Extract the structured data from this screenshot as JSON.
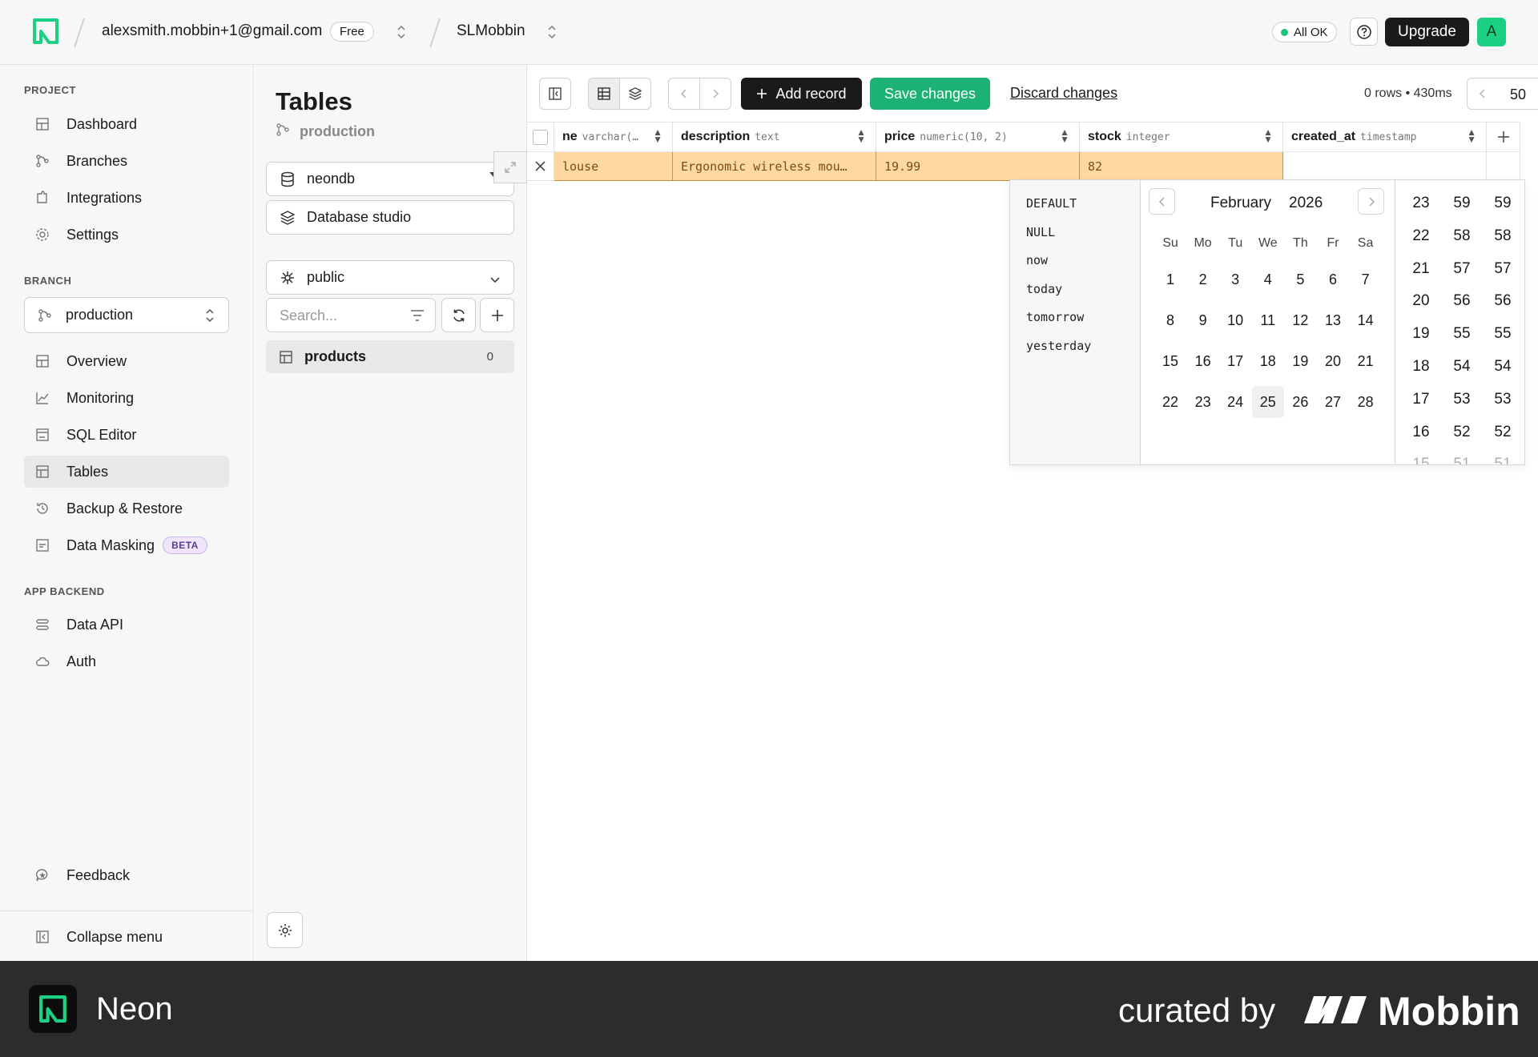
{
  "topbar": {
    "account_email": "alexsmith.mobbin+1@gmail.com",
    "plan_badge": "Free",
    "project_name": "SLMobbin",
    "status": "All OK",
    "upgrade_label": "Upgrade",
    "avatar_initial": "A"
  },
  "sidebar": {
    "project_label": "PROJECT",
    "project_items": [
      "Dashboard",
      "Branches",
      "Integrations",
      "Settings"
    ],
    "branch_label": "BRANCH",
    "branch_value": "production",
    "branch_items": [
      "Overview",
      "Monitoring",
      "SQL Editor",
      "Tables",
      "Backup & Restore",
      "Data Masking"
    ],
    "beta_badge": "BETA",
    "app_backend_label": "APP BACKEND",
    "app_items": [
      "Data API",
      "Auth"
    ],
    "feedback": "Feedback",
    "collapse": "Collapse menu"
  },
  "tables_panel": {
    "title": "Tables",
    "branch": "production",
    "database": "neondb",
    "studio": "Database studio",
    "schema": "public",
    "search_placeholder": "Search...",
    "table_name": "products",
    "table_count": "0"
  },
  "toolbar": {
    "add_record": "Add record",
    "save_changes": "Save changes",
    "discard_changes": "Discard changes",
    "row_info": "0 rows • 430ms",
    "page_size": "50"
  },
  "grid": {
    "columns": [
      {
        "name": "ne",
        "type": "varchar(…"
      },
      {
        "name": "description",
        "type": "text"
      },
      {
        "name": "price",
        "type": "numeric(10, 2)"
      },
      {
        "name": "stock",
        "type": "integer"
      },
      {
        "name": "created_at",
        "type": "timestamp"
      }
    ],
    "row": [
      "louse",
      "Ergonomic wireless mou…",
      "19.99",
      "82",
      ""
    ]
  },
  "datepicker": {
    "presets": [
      "DEFAULT",
      "NULL",
      "now",
      "today",
      "tomorrow",
      "yesterday"
    ],
    "month": "February",
    "year": "2026",
    "weekdays": [
      "Su",
      "Mo",
      "Tu",
      "We",
      "Th",
      "Fr",
      "Sa"
    ],
    "days": [
      "1",
      "2",
      "3",
      "4",
      "5",
      "6",
      "7",
      "8",
      "9",
      "10",
      "11",
      "12",
      "13",
      "14",
      "15",
      "16",
      "17",
      "18",
      "19",
      "20",
      "21",
      "22",
      "23",
      "24",
      "25",
      "26",
      "27",
      "28"
    ],
    "selected_day": "25",
    "hours": [
      "23",
      "22",
      "21",
      "20",
      "19",
      "18",
      "17",
      "16",
      "15"
    ],
    "minutes": [
      "59",
      "58",
      "57",
      "56",
      "55",
      "54",
      "53",
      "52",
      "51"
    ],
    "seconds": [
      "59",
      "58",
      "57",
      "56",
      "55",
      "54",
      "53",
      "52",
      "51"
    ]
  },
  "banner": {
    "app_name": "Neon",
    "curated_by": "curated by",
    "brand": "Mobbin"
  },
  "colors": {
    "accent_green": "#1bb273",
    "edited_cell": "#fed8a0",
    "status_dot": "#1bc47d"
  }
}
